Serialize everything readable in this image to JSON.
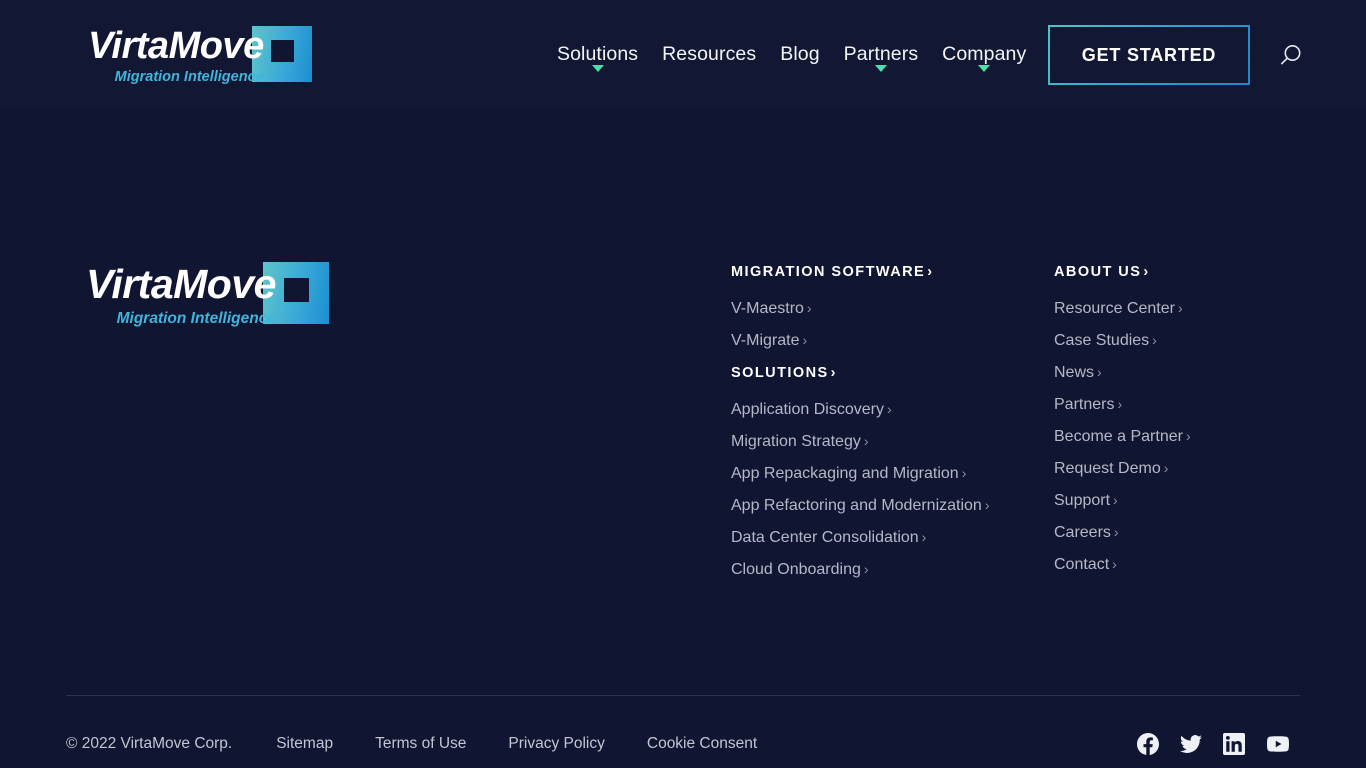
{
  "brand": {
    "name": "VirtaMove",
    "tagline": "Migration Intelligence",
    "accent_teal": "#4bc7c4",
    "accent_blue": "#1d86cc",
    "caret_green": "#4ee0a8",
    "background": "#101531",
    "header_background": "#121734"
  },
  "header": {
    "nav": [
      {
        "label": "Solutions",
        "has_dropdown": true
      },
      {
        "label": "Resources",
        "has_dropdown": false
      },
      {
        "label": "Blog",
        "has_dropdown": false
      },
      {
        "label": "Partners",
        "has_dropdown": true
      },
      {
        "label": "Company",
        "has_dropdown": true
      }
    ],
    "cta_label": "GET STARTED",
    "search_icon": "search-icon"
  },
  "footer": {
    "columns": [
      {
        "id": "migration-software",
        "heading": "MIGRATION SOFTWARE",
        "heading_arrow": "›",
        "links": [
          {
            "label": "V-Maestro",
            "arrow": "›"
          },
          {
            "label": "V-Migrate",
            "arrow": "›"
          }
        ],
        "sub_heading": "SOLUTIONS",
        "sub_heading_arrow": "›",
        "sub_links": [
          {
            "label": "Application Discovery",
            "arrow": "›"
          },
          {
            "label": "Migration Strategy",
            "arrow": "›"
          },
          {
            "label": "App Repackaging and Migration",
            "arrow": "›"
          },
          {
            "label": "App Refactoring and Modernization",
            "arrow": "›"
          },
          {
            "label": "Data Center Consolidation",
            "arrow": "›"
          },
          {
            "label": "Cloud Onboarding",
            "arrow": "›"
          }
        ]
      },
      {
        "id": "about-us",
        "heading": "ABOUT US",
        "heading_arrow": "›",
        "links": [
          {
            "label": "Resource Center",
            "arrow": "›"
          },
          {
            "label": "Case Studies",
            "arrow": "›"
          },
          {
            "label": "News",
            "arrow": "›"
          },
          {
            "label": "Partners",
            "arrow": "›"
          },
          {
            "label": "Become a Partner",
            "arrow": "›"
          },
          {
            "label": "Request Demo",
            "arrow": "›"
          },
          {
            "label": "Support",
            "arrow": "›"
          },
          {
            "label": "Careers",
            "arrow": "›"
          },
          {
            "label": "Contact",
            "arrow": "›"
          }
        ]
      }
    ]
  },
  "bottom": {
    "copyright": "© 2022 VirtaMove Corp.",
    "links": [
      {
        "label": "Sitemap"
      },
      {
        "label": "Terms of Use"
      },
      {
        "label": "Privacy Policy"
      },
      {
        "label": "Cookie Consent"
      }
    ],
    "socials": [
      {
        "name": "facebook-icon"
      },
      {
        "name": "twitter-icon"
      },
      {
        "name": "linkedin-icon"
      },
      {
        "name": "youtube-icon"
      }
    ]
  }
}
